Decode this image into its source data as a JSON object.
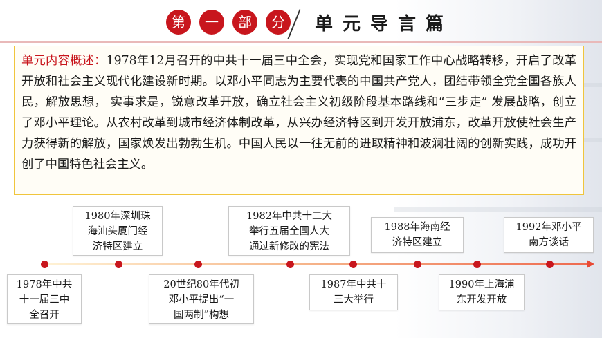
{
  "header": {
    "part_chars": [
      "第",
      "一",
      "部",
      "分"
    ],
    "section_title": "单元导言篇"
  },
  "content": {
    "label": "单元内容概述：",
    "text": "1978年12月召开的中共十一届三中全会，实现党和国家工作中心战略转移，开启了改革开放和社会主义现代化建设新时期。以邓小平同志为主要代表的中国共产党人，团结带领全党全国各族人民，解放思想，  实事求是，锐意改革开放，确立社会主义初级阶段基本路线和“三步走”  发展战略，创立了邓小平理论。从农村改革到城市经济体制改革，从兴办经济特区到开发开放浦东，改革开放使社会生产力获得新的解放，国家焕发出勃勃生机。中国人民以一往无前的进取精神和波澜壮阔的创新实践，成功开创了中国特色社会主义。"
  },
  "timeline": {
    "events": [
      {
        "lines": [
          "1978年中共",
          "十一届三中",
          "全召开"
        ]
      },
      {
        "lines": [
          "1980年深圳珠",
          "海汕头厦门经",
          "济特区建立"
        ]
      },
      {
        "lines": [
          "20世纪80年代初",
          "邓小平提出“一",
          "国两制”构想"
        ]
      },
      {
        "lines": [
          "1982年中共十二大",
          "举行五届全国人大",
          "通过新修改的宪法"
        ]
      },
      {
        "lines": [
          "1987年中共十",
          "三大举行"
        ]
      },
      {
        "lines": [
          "1988年海南经",
          "济特区建立"
        ]
      },
      {
        "lines": [
          "1990年上海浦",
          "东开发开放"
        ]
      },
      {
        "lines": [
          "1992年邓小平",
          "南方谈话"
        ]
      }
    ]
  },
  "colors": {
    "accent_red": "#c8161d",
    "box_border": "#f0c53c"
  }
}
